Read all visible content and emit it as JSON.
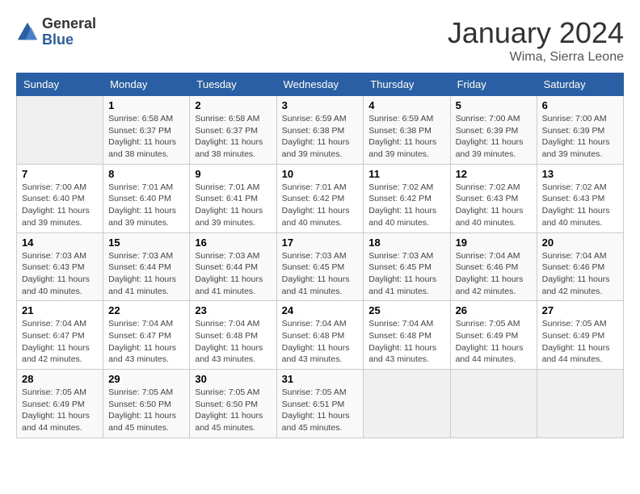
{
  "header": {
    "logo_general": "General",
    "logo_blue": "Blue",
    "month": "January 2024",
    "location": "Wima, Sierra Leone"
  },
  "days_of_week": [
    "Sunday",
    "Monday",
    "Tuesday",
    "Wednesday",
    "Thursday",
    "Friday",
    "Saturday"
  ],
  "weeks": [
    [
      {
        "day": "",
        "info": ""
      },
      {
        "day": "1",
        "info": "Sunrise: 6:58 AM\nSunset: 6:37 PM\nDaylight: 11 hours\nand 38 minutes."
      },
      {
        "day": "2",
        "info": "Sunrise: 6:58 AM\nSunset: 6:37 PM\nDaylight: 11 hours\nand 38 minutes."
      },
      {
        "day": "3",
        "info": "Sunrise: 6:59 AM\nSunset: 6:38 PM\nDaylight: 11 hours\nand 39 minutes."
      },
      {
        "day": "4",
        "info": "Sunrise: 6:59 AM\nSunset: 6:38 PM\nDaylight: 11 hours\nand 39 minutes."
      },
      {
        "day": "5",
        "info": "Sunrise: 7:00 AM\nSunset: 6:39 PM\nDaylight: 11 hours\nand 39 minutes."
      },
      {
        "day": "6",
        "info": "Sunrise: 7:00 AM\nSunset: 6:39 PM\nDaylight: 11 hours\nand 39 minutes."
      }
    ],
    [
      {
        "day": "7",
        "info": ""
      },
      {
        "day": "8",
        "info": "Sunrise: 7:01 AM\nSunset: 6:40 PM\nDaylight: 11 hours\nand 39 minutes."
      },
      {
        "day": "9",
        "info": "Sunrise: 7:01 AM\nSunset: 6:41 PM\nDaylight: 11 hours\nand 39 minutes."
      },
      {
        "day": "10",
        "info": "Sunrise: 7:01 AM\nSunset: 6:42 PM\nDaylight: 11 hours\nand 40 minutes."
      },
      {
        "day": "11",
        "info": "Sunrise: 7:02 AM\nSunset: 6:42 PM\nDaylight: 11 hours\nand 40 minutes."
      },
      {
        "day": "12",
        "info": "Sunrise: 7:02 AM\nSunset: 6:43 PM\nDaylight: 11 hours\nand 40 minutes."
      },
      {
        "day": "13",
        "info": "Sunrise: 7:02 AM\nSunset: 6:43 PM\nDaylight: 11 hours\nand 40 minutes."
      }
    ],
    [
      {
        "day": "14",
        "info": ""
      },
      {
        "day": "15",
        "info": "Sunrise: 7:03 AM\nSunset: 6:44 PM\nDaylight: 11 hours\nand 41 minutes."
      },
      {
        "day": "16",
        "info": "Sunrise: 7:03 AM\nSunset: 6:44 PM\nDaylight: 11 hours\nand 41 minutes."
      },
      {
        "day": "17",
        "info": "Sunrise: 7:03 AM\nSunset: 6:45 PM\nDaylight: 11 hours\nand 41 minutes."
      },
      {
        "day": "18",
        "info": "Sunrise: 7:03 AM\nSunset: 6:45 PM\nDaylight: 11 hours\nand 41 minutes."
      },
      {
        "day": "19",
        "info": "Sunrise: 7:04 AM\nSunset: 6:46 PM\nDaylight: 11 hours\nand 42 minutes."
      },
      {
        "day": "20",
        "info": "Sunrise: 7:04 AM\nSunset: 6:46 PM\nDaylight: 11 hours\nand 42 minutes."
      }
    ],
    [
      {
        "day": "21",
        "info": ""
      },
      {
        "day": "22",
        "info": "Sunrise: 7:04 AM\nSunset: 6:47 PM\nDaylight: 11 hours\nand 43 minutes."
      },
      {
        "day": "23",
        "info": "Sunrise: 7:04 AM\nSunset: 6:48 PM\nDaylight: 11 hours\nand 43 minutes."
      },
      {
        "day": "24",
        "info": "Sunrise: 7:04 AM\nSunset: 6:48 PM\nDaylight: 11 hours\nand 43 minutes."
      },
      {
        "day": "25",
        "info": "Sunrise: 7:04 AM\nSunset: 6:48 PM\nDaylight: 11 hours\nand 43 minutes."
      },
      {
        "day": "26",
        "info": "Sunrise: 7:05 AM\nSunset: 6:49 PM\nDaylight: 11 hours\nand 44 minutes."
      },
      {
        "day": "27",
        "info": "Sunrise: 7:05 AM\nSunset: 6:49 PM\nDaylight: 11 hours\nand 44 minutes."
      }
    ],
    [
      {
        "day": "28",
        "info": "Sunrise: 7:05 AM\nSunset: 6:49 PM\nDaylight: 11 hours\nand 44 minutes."
      },
      {
        "day": "29",
        "info": "Sunrise: 7:05 AM\nSunset: 6:50 PM\nDaylight: 11 hours\nand 45 minutes."
      },
      {
        "day": "30",
        "info": "Sunrise: 7:05 AM\nSunset: 6:50 PM\nDaylight: 11 hours\nand 45 minutes."
      },
      {
        "day": "31",
        "info": "Sunrise: 7:05 AM\nSunset: 6:51 PM\nDaylight: 11 hours\nand 45 minutes."
      },
      {
        "day": "",
        "info": ""
      },
      {
        "day": "",
        "info": ""
      },
      {
        "day": "",
        "info": ""
      }
    ]
  ],
  "week1_day7_info": "Sunrise: 7:00 AM\nSunset: 6:40 PM\nDaylight: 11 hours\nand 39 minutes.",
  "week2_day14_info": "Sunrise: 7:03 AM\nSunset: 6:43 PM\nDaylight: 11 hours\nand 40 minutes.",
  "week3_day21_info": "Sunrise: 7:04 AM\nSunset: 6:47 PM\nDaylight: 11 hours\nand 42 minutes."
}
